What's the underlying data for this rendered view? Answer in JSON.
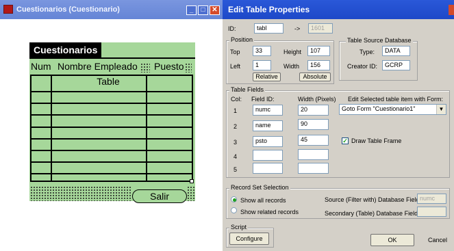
{
  "left_window": {
    "title": "Cuestionarios (Cuestionario)",
    "form": {
      "title": "Cuestionarios",
      "columns": [
        "Num",
        "Nombre Empleado",
        "Puesto"
      ],
      "table_label": "Table",
      "button": "Salir"
    }
  },
  "dialog": {
    "title": "Edit Table Properties",
    "id_label": "ID:",
    "id_value": "tabl",
    "arrow": "->",
    "id_number": "1601",
    "position": {
      "title": "Position",
      "top_label": "Top",
      "top_value": "33",
      "left_label": "Left",
      "left_value": "1",
      "height_label": "Height",
      "height_value": "107",
      "width_label": "Width",
      "width_value": "156",
      "relative_button": "Relative",
      "absolute_button": "Absolute"
    },
    "source_db": {
      "title": "Table Source Database",
      "type_label": "Type:",
      "type_value": "DATA",
      "creator_label": "Creator ID:",
      "creator_value": "GCRP"
    },
    "fields": {
      "title": "Table Fields",
      "col_header": "Col:",
      "field_header": "Field ID:",
      "width_header": "Width (Pixels)",
      "edit_header": "Edit  Selected table item with Form:",
      "rows": [
        {
          "col": "1",
          "field": "numc",
          "width": "20"
        },
        {
          "col": "2",
          "field": "name",
          "width": "90"
        },
        {
          "col": "3",
          "field": "psto",
          "width": "45"
        },
        {
          "col": "4",
          "field": "",
          "width": ""
        },
        {
          "col": "5",
          "field": "",
          "width": ""
        }
      ],
      "form_select": "Goto Form \"Cuestionario1\"",
      "draw_frame_label": "Draw Table Frame",
      "draw_frame_checked": true
    },
    "recordset": {
      "title": "Record Set Selection",
      "show_all": "Show all records",
      "show_related": "Show related records",
      "source_label": "Source (Filter with) Database Field:",
      "source_value": "numc",
      "secondary_label": "Secondary (Table) Database Field:",
      "secondary_value": "",
      "selected": "show_all"
    },
    "script": {
      "title": "Script",
      "configure_button": "Configure"
    },
    "ok_button": "OK",
    "cancel_button": "Cancel"
  },
  "colors": {
    "form_green": "#a6d79a",
    "left_titlebar": "#7a96df",
    "dialog_titlebar": "#2a58d8",
    "dialog_bg": "#d4d0c8"
  }
}
